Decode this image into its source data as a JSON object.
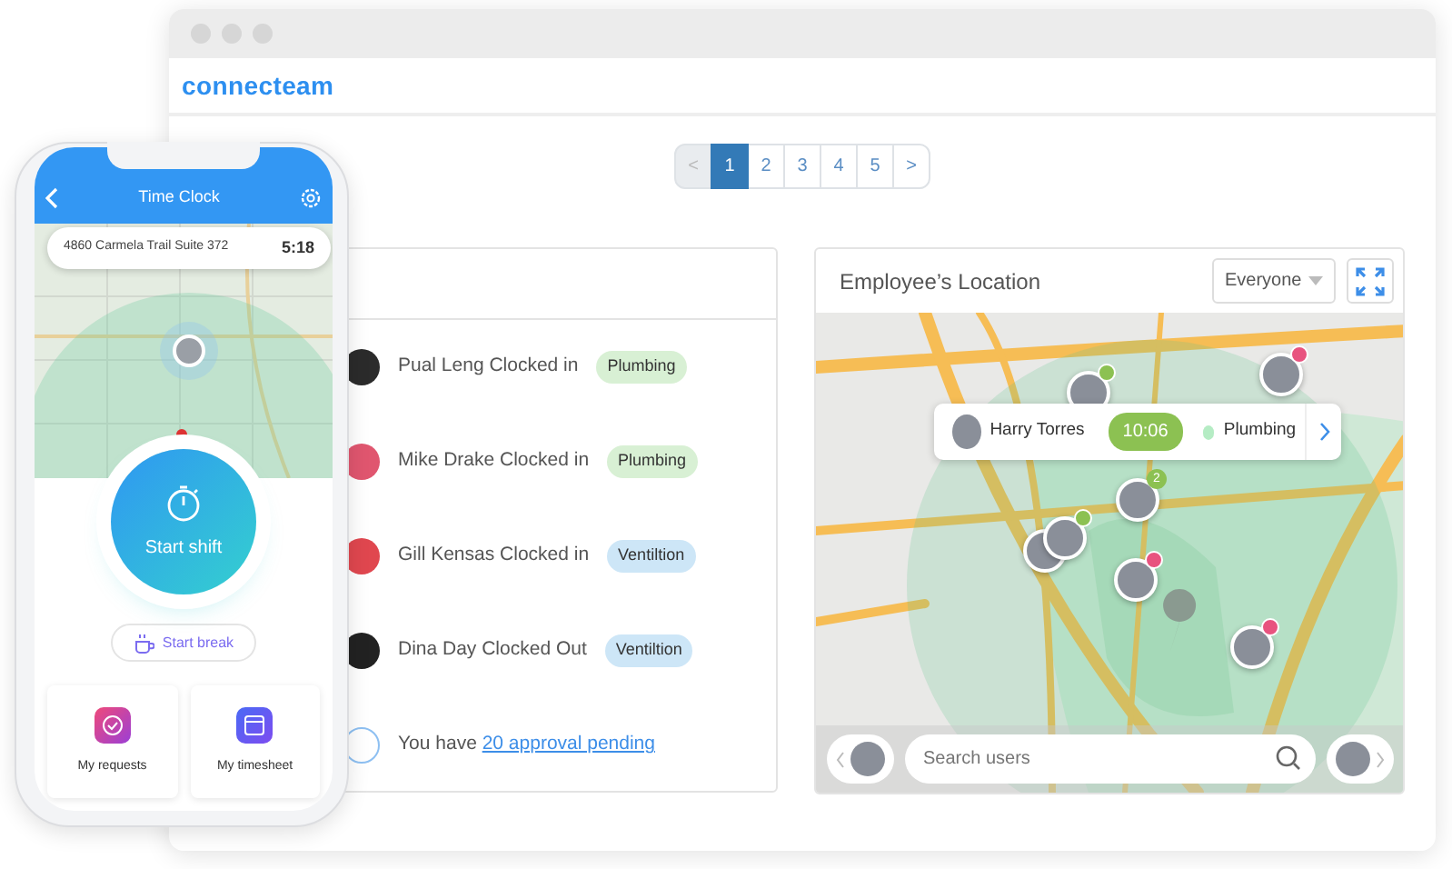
{
  "browser": {
    "logo": "connecteam"
  },
  "pagination": {
    "items": [
      {
        "label": "<",
        "selected": false,
        "disabled": true
      },
      {
        "label": "1",
        "selected": true,
        "disabled": false
      },
      {
        "label": "2",
        "selected": false,
        "disabled": false
      },
      {
        "label": "3",
        "selected": false,
        "disabled": false
      },
      {
        "label": "4",
        "selected": false,
        "disabled": false
      },
      {
        "label": "5",
        "selected": false,
        "disabled": false
      },
      {
        "label": ">",
        "selected": false,
        "disabled": false
      }
    ]
  },
  "activity": {
    "items": [
      {
        "kind": "clock",
        "text": "Pual Leng Clocked in",
        "tag": "Plumbing",
        "color": "#d8f0d4"
      },
      {
        "kind": "clock",
        "text": "Mike Drake Clocked in",
        "tag": "Plumbing",
        "color": "#d8f0d4"
      },
      {
        "kind": "clock",
        "text": "Gill Kensas Clocked in",
        "tag": "Ventiltion",
        "color": "#cde6f7"
      },
      {
        "kind": "clock",
        "text": "Dina Day Clocked Out",
        "tag": "Ventiltion",
        "color": "#cde6f7"
      },
      {
        "kind": "notice",
        "text": "You have ",
        "link": "20 approval pending"
      }
    ]
  },
  "location": {
    "title": "Employee’s Location",
    "filter": "Everyone",
    "popup": {
      "name": "Harry Torres",
      "time": "10:06",
      "tag": "Plumbing"
    },
    "markers": [
      {
        "kind": "single",
        "color": "#8cc152"
      },
      {
        "kind": "single",
        "color": "#e8537f"
      },
      {
        "kind": "single",
        "color": "#8cc152",
        "badge": "2"
      },
      {
        "kind": "group",
        "color": "#8cc152"
      },
      {
        "kind": "single",
        "color": "#e8537f"
      },
      {
        "kind": "single",
        "color": "#e8537f"
      }
    ],
    "search": {
      "placeholder": "Search users"
    }
  },
  "phone": {
    "title": "Time Clock",
    "address": "4860 Carmela Trail Suite 372",
    "time": "5:18",
    "primary": "Start shift",
    "secondary": "Start break",
    "tiles": [
      {
        "kind": "requests",
        "label": "My requests"
      },
      {
        "kind": "timesheet",
        "label": "My timesheet"
      }
    ]
  }
}
